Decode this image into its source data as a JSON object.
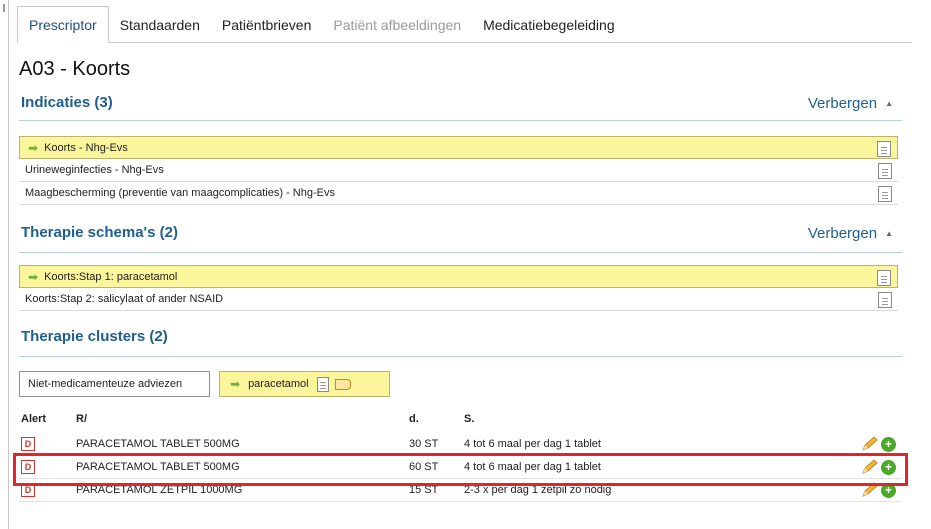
{
  "tabs": [
    {
      "label": "Prescriptor",
      "state": "active"
    },
    {
      "label": "Standaarden",
      "state": "normal"
    },
    {
      "label": "Patiëntbrieven",
      "state": "normal"
    },
    {
      "label": "Patiënt afbeeldingen",
      "state": "disabled"
    },
    {
      "label": "Medicatiebegeleiding",
      "state": "normal"
    }
  ],
  "page_title": "A03 - Koorts",
  "indicaties": {
    "title": "Indicaties (3)",
    "hide_label": "Verbergen",
    "items": [
      {
        "label": "Koorts - Nhg-Evs",
        "selected": true
      },
      {
        "label": "Urineweginfecties - Nhg-Evs",
        "selected": false
      },
      {
        "label": "Maagbescherming (preventie van maagcomplicaties) - Nhg-Evs",
        "selected": false
      }
    ]
  },
  "schemas": {
    "title": "Therapie schema's (2)",
    "hide_label": "Verbergen",
    "items": [
      {
        "label": "Koorts:Stap 1: paracetamol",
        "selected": true
      },
      {
        "label": "Koorts:Stap 2: salicylaat of ander NSAID",
        "selected": false
      }
    ]
  },
  "clusters": {
    "title": "Therapie clusters (2)",
    "buttons": [
      {
        "label": "Niet-medicamenteuze adviezen",
        "selected": false
      },
      {
        "label": "paracetamol",
        "selected": true
      }
    ]
  },
  "medication_table": {
    "headers": {
      "alert": "Alert",
      "r": "R/",
      "d": "d.",
      "s": "S."
    },
    "rows": [
      {
        "alert": "D",
        "name": "PARACETAMOL TABLET 500MG",
        "qty": "30 ST",
        "dose": "4 tot 6 maal per dag 1 tablet"
      },
      {
        "alert": "D",
        "name": "PARACETAMOL TABLET 500MG",
        "qty": "60 ST",
        "dose": "4 tot 6 maal per dag 1 tablet"
      },
      {
        "alert": "D",
        "name": "PARACETAMOL ZETPIL 1000MG",
        "qty": "15 ST",
        "dose": "2-3 x per dag 1 zetpil zo nodig"
      }
    ]
  },
  "icons": {
    "arrow": "arrow-right-icon",
    "document": "document-icon",
    "edit": "pencil-icon",
    "add": "plus-icon"
  },
  "colors": {
    "accent": "#1f5f8f",
    "selected_row": "#fbf59c",
    "alert_red": "#d0342c",
    "highlight": "#e0262b",
    "add_green": "#4ca82a"
  }
}
